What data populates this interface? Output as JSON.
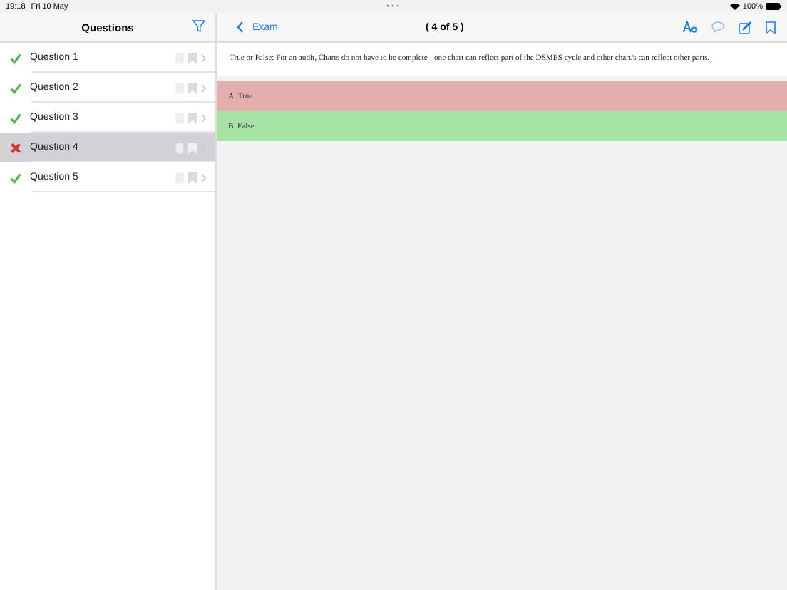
{
  "status_bar": {
    "time": "19:18",
    "date": "Fri 10 May",
    "battery": "100%"
  },
  "sidebar": {
    "title": "Questions",
    "items": [
      {
        "label": "Question 1",
        "correct": true,
        "selected": false
      },
      {
        "label": "Question 2",
        "correct": true,
        "selected": false
      },
      {
        "label": "Question 3",
        "correct": true,
        "selected": false
      },
      {
        "label": "Question 4",
        "correct": false,
        "selected": true
      },
      {
        "label": "Question 5",
        "correct": true,
        "selected": false
      }
    ]
  },
  "header": {
    "back": "Exam",
    "title": "( 4 of 5 )"
  },
  "question": "True or False: For an audit, Charts do not have to be complete - one chart can reflect part of the DSMES cycle and other chart/s can reflect other parts.",
  "answers": [
    {
      "label": "A. True",
      "correct": false
    },
    {
      "label": "B. False",
      "correct": true
    }
  ]
}
